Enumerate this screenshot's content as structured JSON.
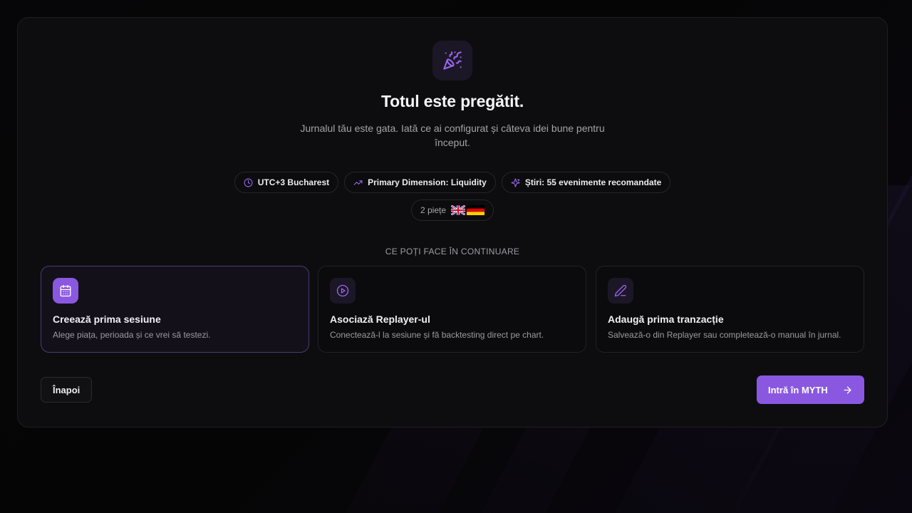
{
  "hero": {
    "icon": "party-popper-icon",
    "title": "Totul este pregătit.",
    "subtitle": "Jurnalul tău este gata. Iată ce ai configurat și câteva idei bune pentru început."
  },
  "chips": {
    "timezone": {
      "icon": "clock-icon",
      "label": "UTC+3 Bucharest"
    },
    "dimension": {
      "icon": "trending-up-icon",
      "label": "Primary Dimension: Liquidity"
    },
    "news": {
      "icon": "sparkles-icon",
      "label": "Știri: 55 evenimente recomandate"
    },
    "markets": {
      "label": "2 piețe",
      "flags": [
        "uk-flag",
        "germany-flag"
      ]
    }
  },
  "section_label": "CE POȚI FACE ÎN CONTINUARE",
  "actions": [
    {
      "icon": "calendar-icon",
      "title": "Creează prima sesiune",
      "description": "Alege piața, perioada și ce vrei să testezi."
    },
    {
      "icon": "play-circle-icon",
      "title": "Asociază Replayer-ul",
      "description": "Conectează-l la sesiune și fă backtesting direct pe chart."
    },
    {
      "icon": "pencil-icon",
      "title": "Adaugă prima tranzacție",
      "description": "Salvează-o din Replayer sau completează-o manual în jurnal."
    }
  ],
  "footer": {
    "back_label": "Înapoi",
    "enter_label": "Intră în MYTH",
    "enter_icon": "arrow-right-icon"
  },
  "colors": {
    "accent": "#8a58e0",
    "background": "#050505",
    "card": "#0e0e10"
  }
}
